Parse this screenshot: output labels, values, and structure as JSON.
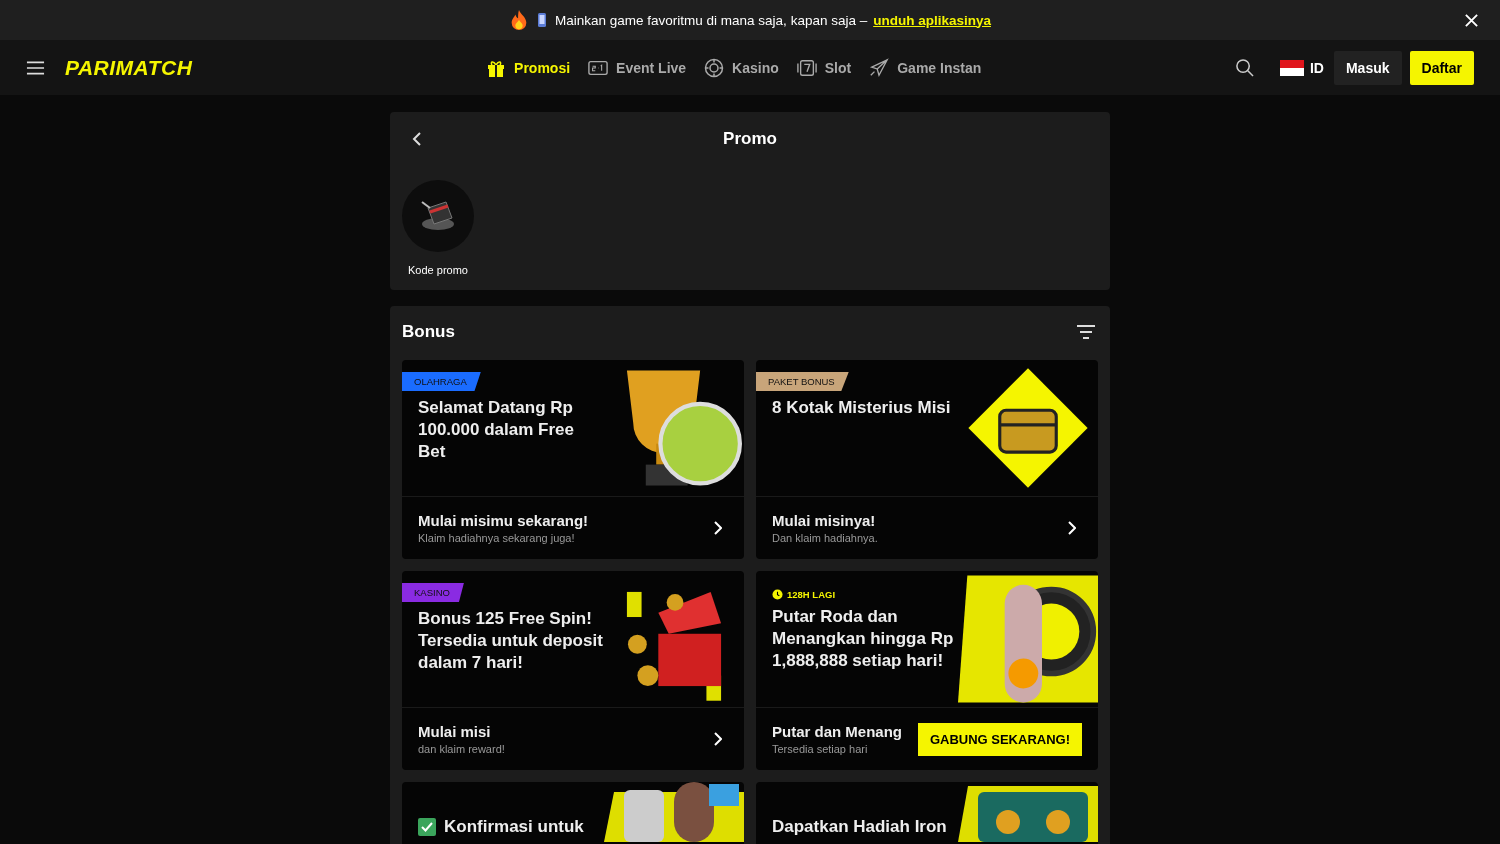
{
  "announcement": {
    "text": "Mainkan game favoritmu di mana saja, kapan saja –",
    "link": "unduh aplikasinya"
  },
  "header": {
    "logo": "PARIMATCH",
    "nav": [
      {
        "label": "Promosi",
        "selected": true
      },
      {
        "label": "Event Live",
        "selected": false
      },
      {
        "label": "Kasino",
        "selected": false
      },
      {
        "label": "Slot",
        "selected": false
      },
      {
        "label": "Game Instan",
        "selected": false
      }
    ],
    "language": "ID",
    "login": "Masuk",
    "register": "Daftar"
  },
  "promo_panel": {
    "title": "Promo",
    "items": [
      {
        "label": "Kode promo"
      }
    ]
  },
  "bonus": {
    "title": "Bonus",
    "cards": [
      {
        "tag": "OLAHRAGA",
        "color": "#1a6cff",
        "title": "Selamat Datang Rp 100.000 dalam Free Bet",
        "footer_title": "Mulai misimu sekarang!",
        "footer_subtitle": "Klaim hadiahnya sekarang juga!"
      },
      {
        "tag": "PAKET BONUS",
        "color": "#c8a57a",
        "title": "8 Kotak Misterius Misi",
        "footer_title": "Mulai misinya!",
        "footer_subtitle": "Dan klaim hadiahnya."
      },
      {
        "tag": "KASINO",
        "color": "#8a2be2",
        "title": "Bonus 125 Free Spin! Tersedia untuk deposit dalam 7 hari!",
        "footer_title": "Mulai misi",
        "footer_subtitle": "dan klaim reward!"
      },
      {
        "timer": "128H LAGI",
        "title": "Putar Roda dan Menangkan hingga Rp 1,888,888 setiap hari!",
        "footer_title": "Putar dan Menang",
        "footer_subtitle": "Tersedia setiap hari",
        "button": "GABUNG SEKARANG!"
      },
      {
        "title": "Konfirmasi untuk",
        "checked": true
      },
      {
        "title": "Dapatkan Hadiah Iron"
      }
    ]
  }
}
